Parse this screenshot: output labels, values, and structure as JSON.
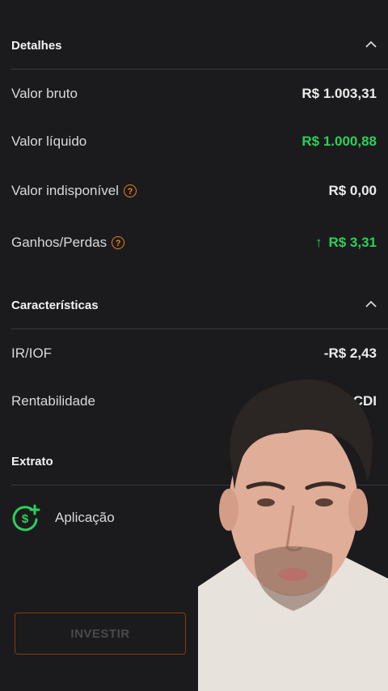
{
  "detalhes": {
    "title": "Detalhes",
    "rows": [
      {
        "label": "Valor bruto",
        "value": "R$ 1.003,31"
      },
      {
        "label": "Valor líquido",
        "value": "R$ 1.000,88"
      },
      {
        "label": "Valor indisponível",
        "value": "R$ 0,00"
      },
      {
        "label": "Ganhos/Perdas",
        "value": "R$ 3,31",
        "arrow": "↑"
      }
    ]
  },
  "caracteristicas": {
    "title": "Características",
    "rows": [
      {
        "label": "IR/IOF",
        "value": "-R$ 2,43"
      },
      {
        "label": "Rentabilidade",
        "value": "A partir de ... CDI"
      }
    ]
  },
  "extrato": {
    "title": "Extrato",
    "items": [
      {
        "label": "Aplicação",
        "icon": "dollar-plus-icon"
      }
    ]
  },
  "help_glyph": "?",
  "invest_button": "INVESTIR",
  "colors": {
    "background": "#1b1b1d",
    "positive": "#2bd05a",
    "accent_orange": "#f07f1e"
  }
}
